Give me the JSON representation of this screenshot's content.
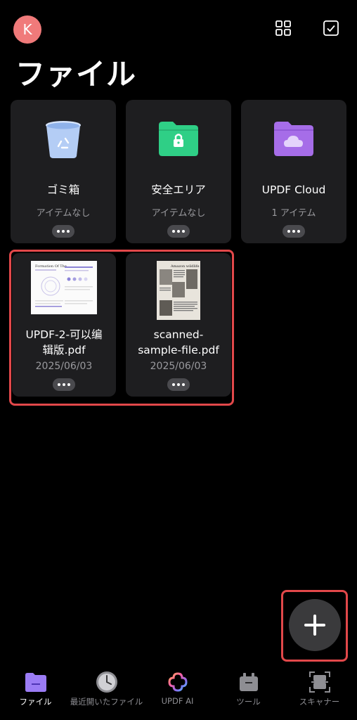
{
  "header": {
    "avatar_initial": "K",
    "title": "ファイル",
    "icons": [
      "grid-view-icon",
      "select-checkbox-icon"
    ]
  },
  "folders": [
    {
      "name": "ゴミ箱",
      "count": "アイテムなし",
      "icon": "trash-icon",
      "color": "#b4cdf5"
    },
    {
      "name": "安全エリア",
      "count": "アイテムなし",
      "icon": "lock-folder-icon",
      "color": "#2fcf86"
    },
    {
      "name": "UPDF Cloud",
      "count": "1 アイテム",
      "icon": "cloud-folder-icon",
      "color": "#a66de8"
    }
  ],
  "files": [
    {
      "name_line1": "UPDF-2-可以编",
      "name_line2": "辑版.pdf",
      "date": "2025/06/03",
      "thumb_title": "Formation Of The"
    },
    {
      "name_line1": "scanned-",
      "name_line2": "sample-file.pdf",
      "date": "2025/06/03",
      "thumb_title": "Amazon wildlife"
    }
  ],
  "fab": {
    "icon": "plus-icon"
  },
  "tabs": [
    {
      "label": "ファイル",
      "icon": "files-icon",
      "active": true
    },
    {
      "label": "最近開いたファイル",
      "icon": "clock-icon",
      "active": false
    },
    {
      "label": "UPDF AI",
      "icon": "ai-icon",
      "active": false
    },
    {
      "label": "ツール",
      "icon": "toolbox-icon",
      "active": false
    },
    {
      "label": "スキャナー",
      "icon": "scanner-icon",
      "active": false
    }
  ],
  "colors": {
    "accent": "#8a6cf0",
    "highlight": "#e2484a",
    "card": "#1e1e20"
  }
}
